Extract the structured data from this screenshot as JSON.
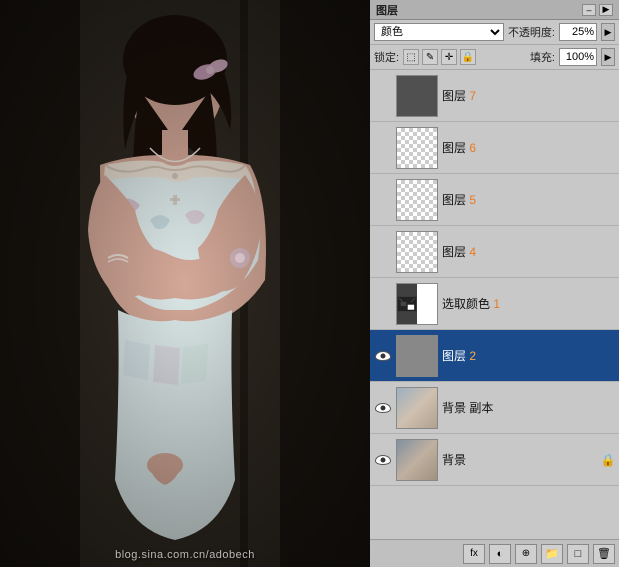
{
  "panel": {
    "title": "图层",
    "blend_mode": "颜色",
    "opacity_label": "不透明度:",
    "opacity_value": "25%",
    "lock_label": "锁定:",
    "fill_label": "填充:",
    "fill_value": "100%",
    "arrow_right": "▶"
  },
  "layers": [
    {
      "id": "layer7",
      "name": "图层 ",
      "num": "7",
      "visible": false,
      "thumb_type": "dark",
      "active": false,
      "locked": false
    },
    {
      "id": "layer6",
      "name": "图层 ",
      "num": "6",
      "visible": false,
      "thumb_type": "checker",
      "active": false,
      "locked": false
    },
    {
      "id": "layer5",
      "name": "图层 ",
      "num": "5",
      "visible": false,
      "thumb_type": "checker",
      "active": false,
      "locked": false
    },
    {
      "id": "layer4",
      "name": "图层 ",
      "num": "4",
      "visible": false,
      "thumb_type": "checker",
      "active": false,
      "locked": false
    },
    {
      "id": "select_color",
      "name": "选取颜色 ",
      "num": "1",
      "visible": false,
      "thumb_type": "selectcolor",
      "active": false,
      "locked": false
    },
    {
      "id": "layer2",
      "name": "图层 ",
      "num": "2",
      "visible": true,
      "thumb_type": "gray",
      "active": true,
      "locked": false
    },
    {
      "id": "bg_copy",
      "name": "背景 副本",
      "num": "",
      "visible": true,
      "thumb_type": "photo",
      "active": false,
      "locked": false
    },
    {
      "id": "background",
      "name": "背景",
      "num": "",
      "visible": true,
      "thumb_type": "photo2",
      "active": false,
      "locked": true
    }
  ],
  "bottom_buttons": [
    "fx",
    "◐",
    "□",
    "✎",
    "🗑"
  ],
  "watermark": "blog.sina.com.cn/adobech"
}
